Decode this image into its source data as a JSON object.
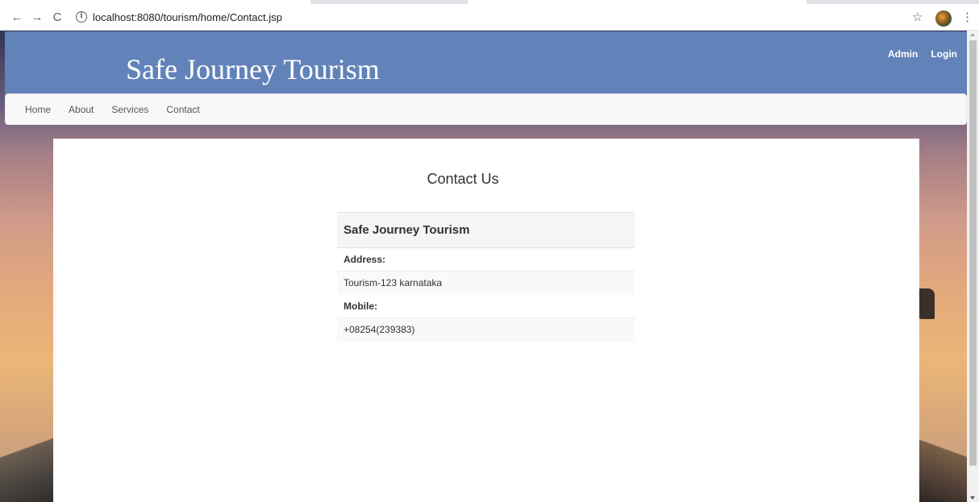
{
  "browser": {
    "url": "localhost:8080/tourism/home/Contact.jsp",
    "back_icon": "←",
    "forward_icon": "→",
    "reload_icon": "C",
    "info_icon": "i",
    "star_icon": "☆",
    "menu_icon": "⋮"
  },
  "header": {
    "title": "Safe Journey Tourism",
    "links": [
      "Admin",
      "Login"
    ]
  },
  "nav": {
    "items": [
      "Home",
      "About",
      "Services",
      "Contact"
    ]
  },
  "main": {
    "heading": "Contact Us",
    "table": {
      "title": "Safe Journey Tourism",
      "address_label": "Address:",
      "address_value": "Tourism-123 karnataka",
      "mobile_label": "Mobile:",
      "mobile_value": "+08254(239383)"
    }
  },
  "colors": {
    "header_band": "#6283b9",
    "navbar": "#f8f8f8",
    "content": "#ffffff"
  }
}
